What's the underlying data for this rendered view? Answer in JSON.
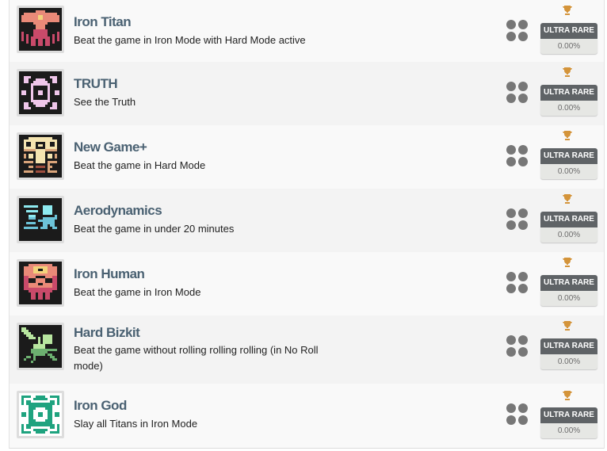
{
  "achievements": [
    {
      "title": "Iron Titan",
      "description": "Beat the game in Iron Mode with Hard Mode active",
      "icon": "iron-titan-icon",
      "rarity": "ULTRA RARE",
      "percent": "0.00%"
    },
    {
      "title": "TRUTH",
      "description": "See the Truth",
      "icon": "truth-eye-icon",
      "rarity": "ULTRA RARE",
      "percent": "0.00%"
    },
    {
      "title": "New Game+",
      "description": "Beat the game in Hard Mode",
      "icon": "new-game-plus-icon",
      "rarity": "ULTRA RARE",
      "percent": "0.00%"
    },
    {
      "title": "Aerodynamics",
      "description": "Beat the game in under 20 minutes",
      "icon": "aerodynamics-icon",
      "rarity": "ULTRA RARE",
      "percent": "0.00%"
    },
    {
      "title": "Iron Human",
      "description": "Beat the game in Iron Mode",
      "icon": "iron-human-skull-icon",
      "rarity": "ULTRA RARE",
      "percent": "0.00%"
    },
    {
      "title": "Hard Bizkit",
      "description": "Beat the game without rolling rolling rolling (in No Roll mode)",
      "icon": "hard-bizkit-icon",
      "rarity": "ULTRA RARE",
      "percent": "0.00%"
    },
    {
      "title": "Iron God",
      "description": "Slay all Titans in Iron Mode",
      "icon": "iron-god-icon",
      "rarity": "ULTRA RARE",
      "percent": "0.00%"
    }
  ],
  "colors": {
    "title": "#4a6172",
    "badge_bg": "#5f6366",
    "percent_bg": "#e6e7e4",
    "trophy": "#d4943a",
    "dots": "#777777"
  }
}
